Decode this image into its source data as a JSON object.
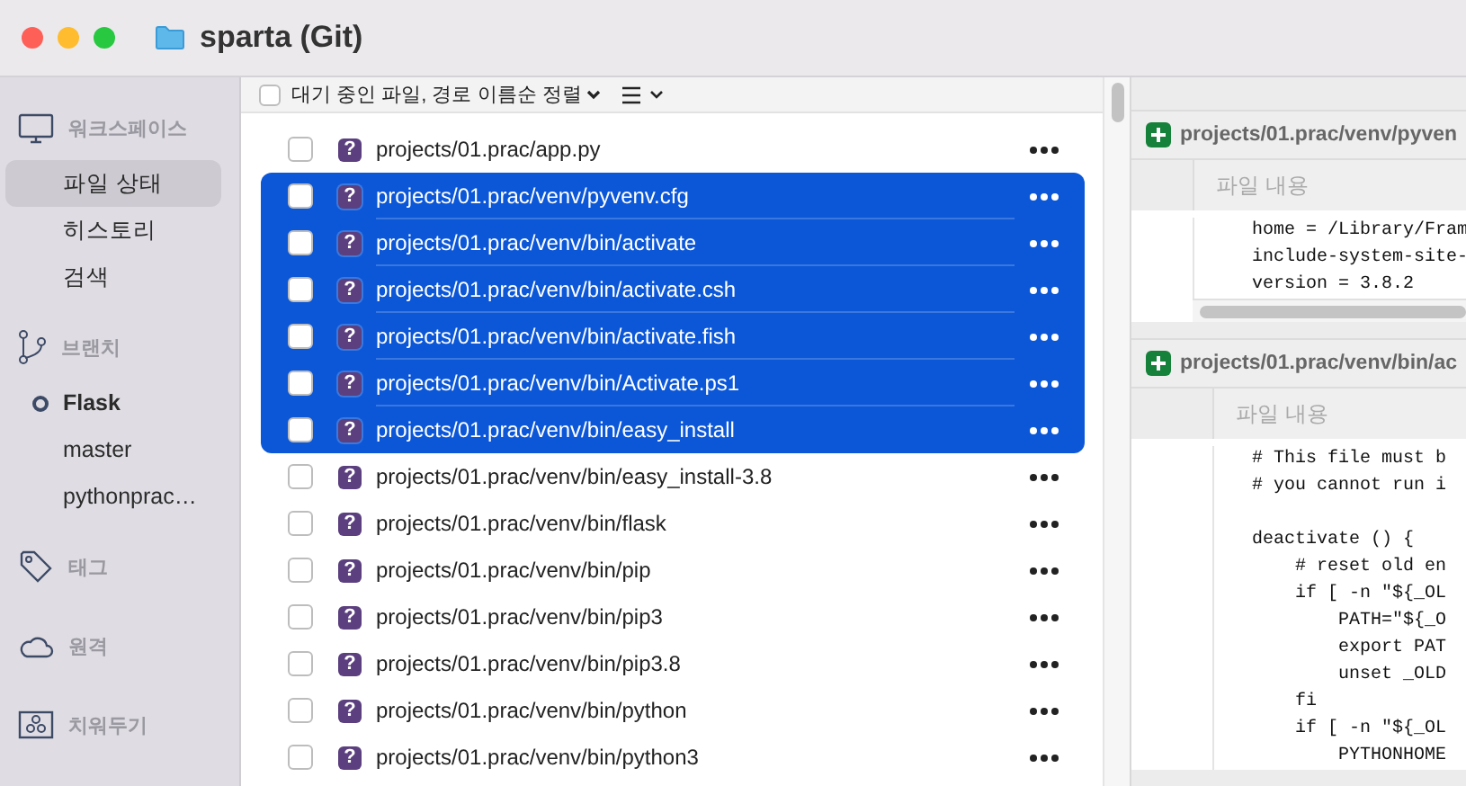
{
  "window": {
    "title": "sparta (Git)"
  },
  "sidebar": {
    "sections": [
      {
        "kind": "workspace",
        "label": "워크스페이스",
        "items": [
          {
            "label": "파일 상태",
            "selected": true
          },
          {
            "label": "히스토리",
            "selected": false
          },
          {
            "label": "검색",
            "selected": false
          }
        ]
      },
      {
        "kind": "branches",
        "label": "브랜치",
        "items": [
          {
            "label": "Flask",
            "current": true
          },
          {
            "label": "master",
            "current": false
          },
          {
            "label": "pythonprac…",
            "current": false
          }
        ]
      },
      {
        "kind": "tags",
        "label": "태그"
      },
      {
        "kind": "remotes",
        "label": "원격"
      },
      {
        "kind": "stashes",
        "label": "치워두기"
      }
    ]
  },
  "file_list": {
    "all_checked": false,
    "sort_label": "대기 중인 파일, 경로 이름순 정렬",
    "files": [
      {
        "path": "projects/01.prac/app.py",
        "badge": "?",
        "kind": "untracked",
        "checked": false,
        "selected": false
      },
      {
        "path": "projects/01.prac/venv/pyvenv.cfg",
        "badge": "?",
        "kind": "untracked",
        "checked": false,
        "selected": true
      },
      {
        "path": "projects/01.prac/venv/bin/activate",
        "badge": "?",
        "kind": "untracked",
        "checked": false,
        "selected": true
      },
      {
        "path": "projects/01.prac/venv/bin/activate.csh",
        "badge": "?",
        "kind": "untracked",
        "checked": false,
        "selected": true
      },
      {
        "path": "projects/01.prac/venv/bin/activate.fish",
        "badge": "?",
        "kind": "untracked",
        "checked": false,
        "selected": true
      },
      {
        "path": "projects/01.prac/venv/bin/Activate.ps1",
        "badge": "?",
        "kind": "untracked",
        "checked": false,
        "selected": true
      },
      {
        "path": "projects/01.prac/venv/bin/easy_install",
        "badge": "?",
        "kind": "untracked",
        "checked": false,
        "selected": true
      },
      {
        "path": "projects/01.prac/venv/bin/easy_install-3.8",
        "badge": "?",
        "kind": "untracked",
        "checked": false,
        "selected": false
      },
      {
        "path": "projects/01.prac/venv/bin/flask",
        "badge": "?",
        "kind": "untracked",
        "checked": false,
        "selected": false
      },
      {
        "path": "projects/01.prac/venv/bin/pip",
        "badge": "?",
        "kind": "untracked",
        "checked": false,
        "selected": false
      },
      {
        "path": "projects/01.prac/venv/bin/pip3",
        "badge": "?",
        "kind": "untracked",
        "checked": false,
        "selected": false
      },
      {
        "path": "projects/01.prac/venv/bin/pip3.8",
        "badge": "?",
        "kind": "untracked",
        "checked": false,
        "selected": false
      },
      {
        "path": "projects/01.prac/venv/bin/python",
        "badge": "?",
        "kind": "untracked",
        "checked": false,
        "selected": false
      },
      {
        "path": "projects/01.prac/venv/bin/python3",
        "badge": "?",
        "kind": "untracked",
        "checked": false,
        "selected": false
      }
    ]
  },
  "diff_panes": [
    {
      "path": "projects/01.prac/venv/pyven",
      "content_label": "파일 내용",
      "lines": [
        {
          "kind": "code",
          "text": "home = /Library/Fram"
        },
        {
          "kind": "code",
          "text": "include-system-site-"
        },
        {
          "kind": "code",
          "text": "version = 3.8.2"
        }
      ]
    },
    {
      "path": "projects/01.prac/venv/bin/ac",
      "content_label": "파일 내용",
      "lines": [
        {
          "kind": "code",
          "text": "# This file must b"
        },
        {
          "kind": "code",
          "text": "# you cannot run i"
        },
        {
          "kind": "blank"
        },
        {
          "kind": "code",
          "text": "deactivate () {"
        },
        {
          "kind": "code",
          "text": "    # reset old en"
        },
        {
          "kind": "code",
          "text": "    if [ -n \"${_OL"
        },
        {
          "kind": "code",
          "text": "        PATH=\"${_O"
        },
        {
          "kind": "code",
          "text": "        export PAT"
        },
        {
          "kind": "code",
          "text": "        unset _OLD"
        },
        {
          "kind": "code",
          "text": "    fi"
        },
        {
          "kind": "code",
          "text": "    if [ -n \"${_OL"
        },
        {
          "kind": "code",
          "text": "        PYTHONHOME"
        }
      ]
    }
  ]
}
